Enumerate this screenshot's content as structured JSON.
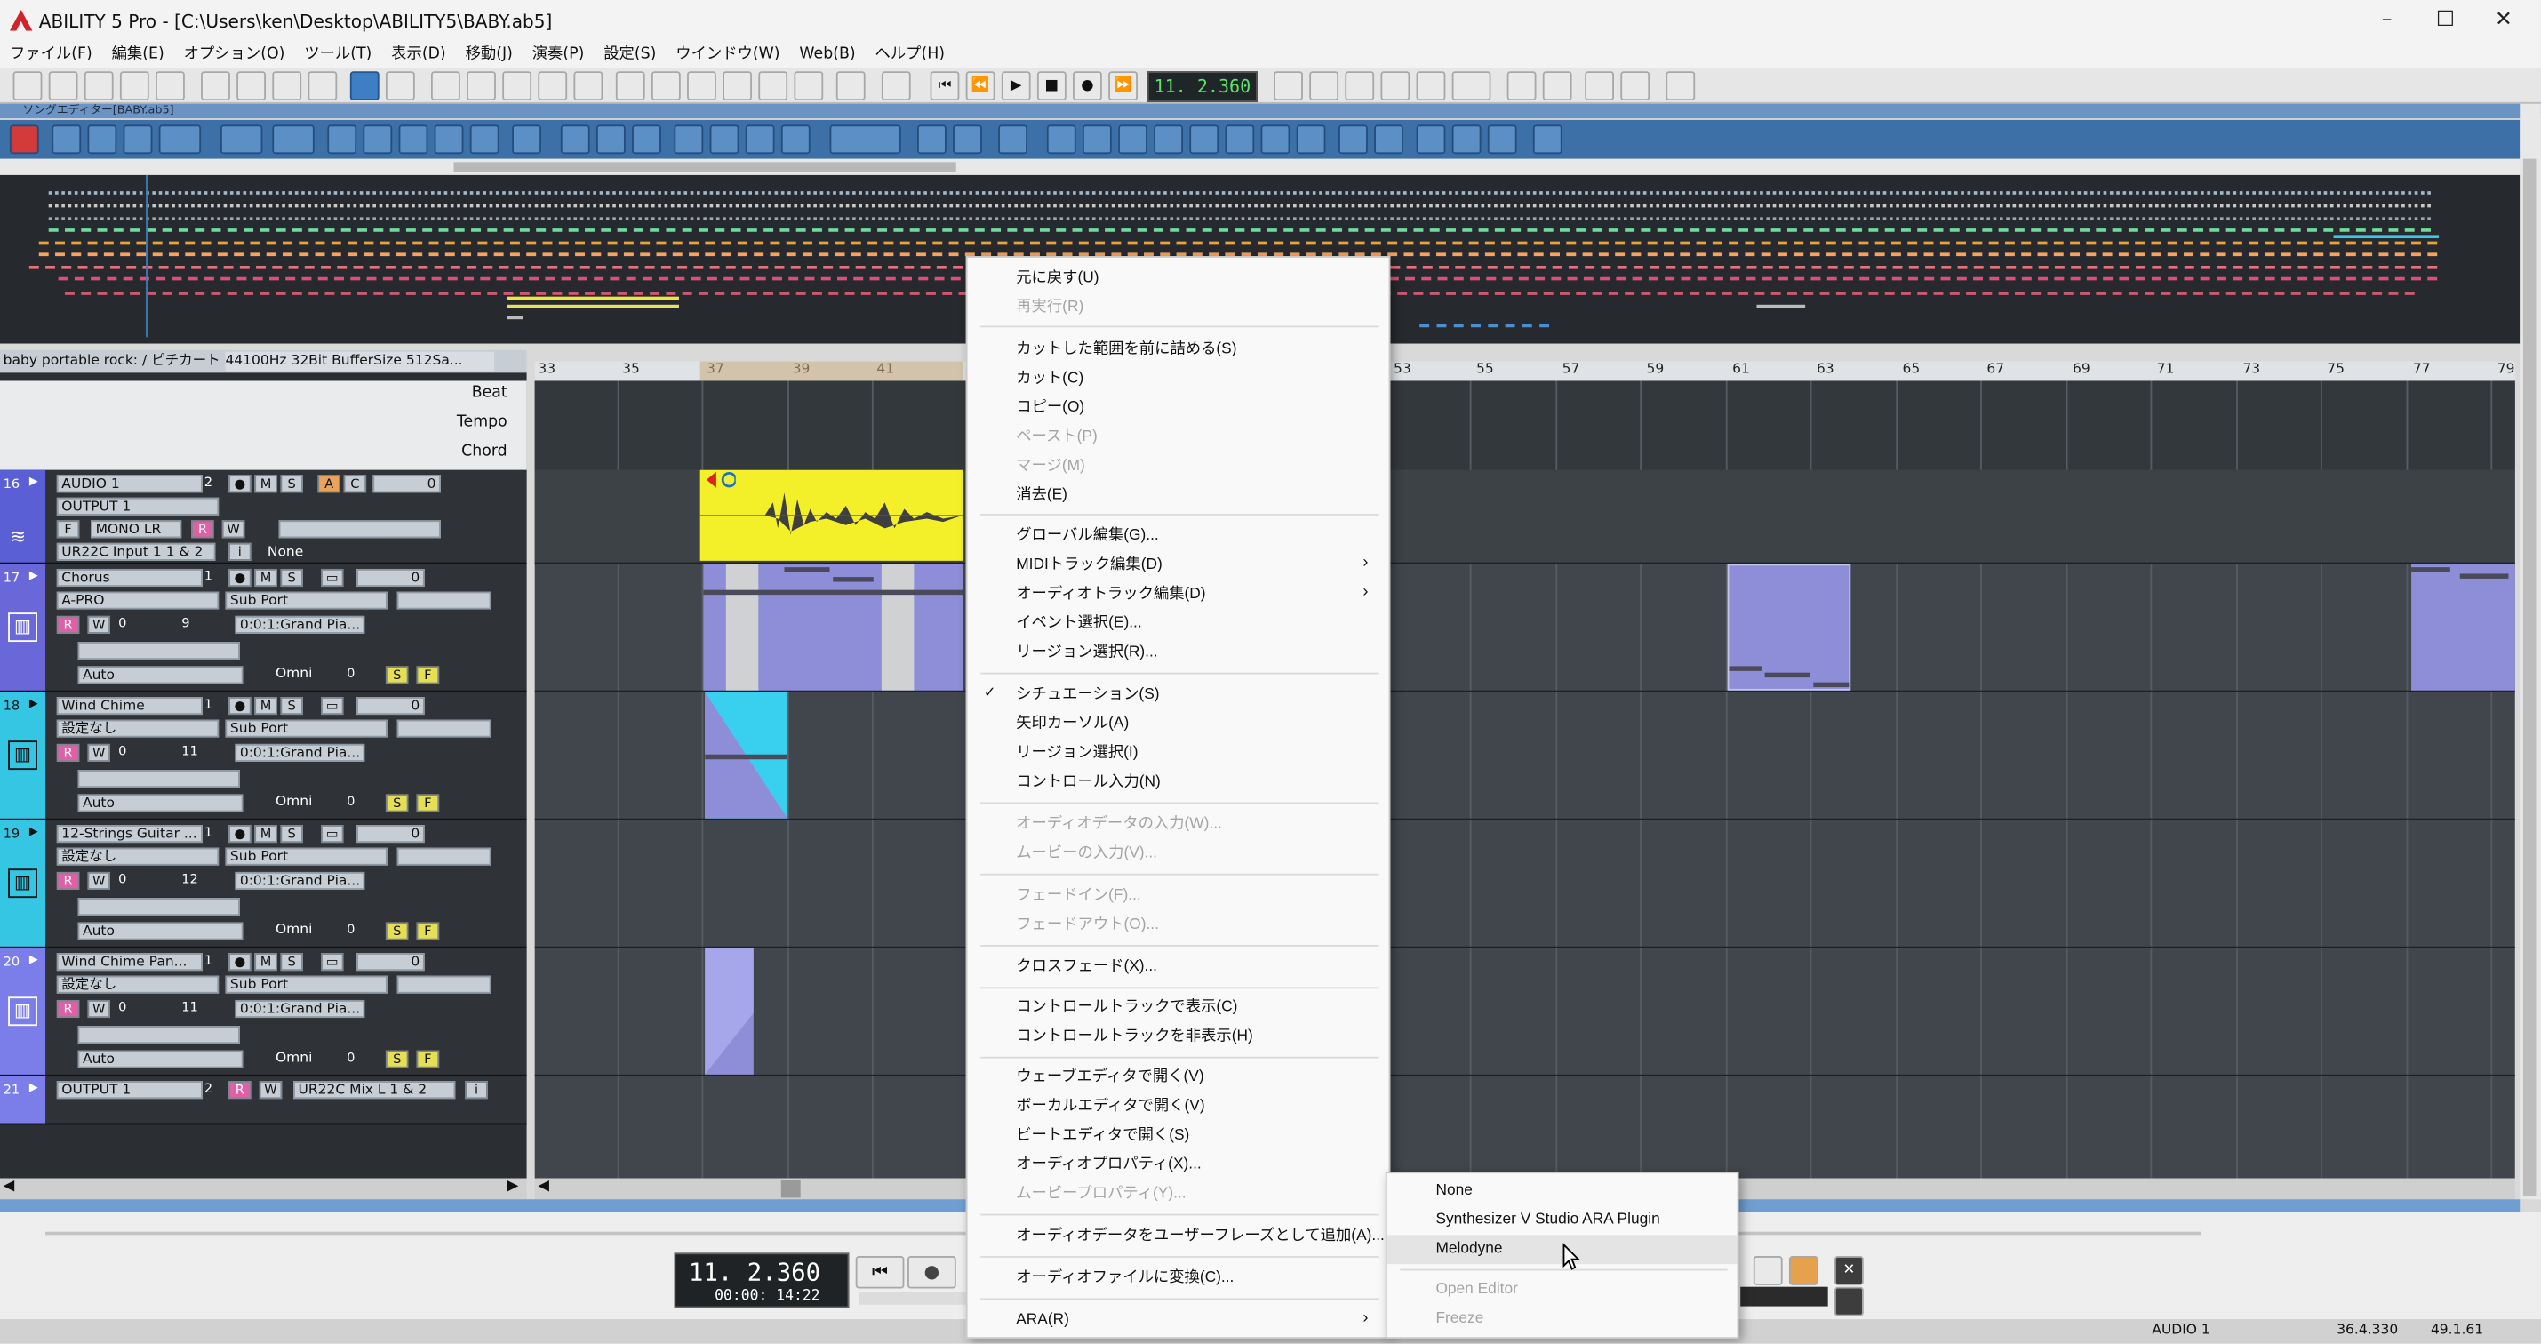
{
  "window": {
    "title": "ABILITY 5 Pro - [C:\\Users\\ken\\Desktop\\ABILITY5\\BABY.ab5]"
  },
  "menubar": [
    "ファイル(F)",
    "編集(E)",
    "オプション(O)",
    "ツール(T)",
    "表示(D)",
    "移動(J)",
    "演奏(P)",
    "設定(S)",
    "ウインドウ(W)",
    "Web(B)",
    "ヘルプ(H)"
  ],
  "transport": {
    "position": "11. 2.360",
    "time": "00:00: 14:22"
  },
  "song_editor": {
    "tab": "ソングエディター[BABY.ab5]",
    "device": "baby portable rock: / ピチカート・",
    "audio_info": "44100Hz 32Bit BufferSize 512Sa...",
    "rows": [
      "Beat",
      "Tempo",
      "Chord"
    ],
    "ruler": [
      "33",
      "35",
      "37",
      "39",
      "41",
      "53",
      "55",
      "57",
      "59",
      "61",
      "63",
      "65",
      "67",
      "69",
      "71",
      "73",
      "75",
      "77",
      "79"
    ]
  },
  "tracks": [
    {
      "no": "16",
      "name": "AUDIO 1",
      "ch": "2",
      "out": "OUTPUT 1",
      "mode": "MONO LR",
      "input": "UR22C Input 1 1 & 2",
      "input2": "None",
      "btn_a": "A",
      "btn_c": "C",
      "vol": "0",
      "color": "#5b5fd6"
    },
    {
      "no": "17",
      "name": "Chorus",
      "ch": "1",
      "port": "A-PRO",
      "sub": "Sub Port",
      "prog": "0:0:1:Grand Pia...",
      "num": "9",
      "auto": "Auto",
      "omni": "Omni",
      "vol": "0",
      "pan": "0",
      "color": "#6a68d8"
    },
    {
      "no": "18",
      "name": "Wind Chime",
      "ch": "1",
      "port": "設定なし",
      "sub": "Sub Port",
      "prog": "0:0:1:Grand Pia...",
      "num": "11",
      "auto": "Auto",
      "omni": "Omni",
      "vol": "0",
      "pan": "0",
      "color": "#35c6e3"
    },
    {
      "no": "19",
      "name": "12-Strings Guitar ...",
      "ch": "1",
      "port": "設定なし",
      "sub": "Sub Port",
      "prog": "0:0:1:Grand Pia...",
      "num": "12",
      "auto": "Auto",
      "omni": "Omni",
      "vol": "0",
      "pan": "0",
      "color": "#35c6e3"
    },
    {
      "no": "20",
      "name": "Wind Chime Pan...",
      "ch": "1",
      "port": "設定なし",
      "sub": "Sub Port",
      "prog": "0:0:1:Grand Pia...",
      "num": "11",
      "auto": "Auto",
      "omni": "Omni",
      "vol": "0",
      "pan": "0",
      "color": "#7b7ee8"
    },
    {
      "no": "21",
      "name": "OUTPUT 1",
      "ch": "2",
      "out": "UR22C Mix L 1 & 2",
      "color": "#7b7ee8"
    }
  ],
  "context_menu": {
    "items": [
      {
        "label": "元に戻す(U)",
        "enabled": true
      },
      {
        "label": "再実行(R)",
        "enabled": false
      },
      {
        "label": "カットした範囲を前に詰める(S)",
        "enabled": true
      },
      {
        "label": "カット(C)",
        "enabled": true
      },
      {
        "label": "コピー(O)",
        "enabled": true
      },
      {
        "label": "ペースト(P)",
        "enabled": false
      },
      {
        "label": "マージ(M)",
        "enabled": false
      },
      {
        "label": "消去(E)",
        "enabled": true
      },
      {
        "label": "グローバル編集(G)...",
        "enabled": true
      },
      {
        "label": "MIDIトラック編集(D)",
        "enabled": true,
        "submenu": true
      },
      {
        "label": "オーディオトラック編集(D)",
        "enabled": true,
        "submenu": true
      },
      {
        "label": "イベント選択(E)...",
        "enabled": true
      },
      {
        "label": "リージョン選択(R)...",
        "enabled": true
      },
      {
        "label": "シチュエーション(S)",
        "enabled": true,
        "checked": true
      },
      {
        "label": "矢印カーソル(A)",
        "enabled": true
      },
      {
        "label": "リージョン選択(I)",
        "enabled": true
      },
      {
        "label": "コントロール入力(N)",
        "enabled": true
      },
      {
        "label": "オーディオデータの入力(W)...",
        "enabled": false
      },
      {
        "label": "ムービーの入力(V)...",
        "enabled": false
      },
      {
        "label": "フェードイン(F)...",
        "enabled": false
      },
      {
        "label": "フェードアウト(O)...",
        "enabled": false
      },
      {
        "label": "クロスフェード(X)...",
        "enabled": true
      },
      {
        "label": "コントロールトラックで表示(C)",
        "enabled": true
      },
      {
        "label": "コントロールトラックを非表示(H)",
        "enabled": true
      },
      {
        "label": "ウェーブエディタで開く(V)",
        "enabled": true
      },
      {
        "label": "ボーカルエディタで開く(V)",
        "enabled": true
      },
      {
        "label": "ビートエディタで開く(S)",
        "enabled": true
      },
      {
        "label": "オーディオプロパティ(X)...",
        "enabled": true
      },
      {
        "label": "ムービープロパティ(Y)...",
        "enabled": false
      },
      {
        "label": "オーディオデータをユーザーフレーズとして追加(A)...",
        "enabled": true
      },
      {
        "label": "オーディオファイルに変換(C)...",
        "enabled": true
      },
      {
        "label": "ARA(R)",
        "enabled": true,
        "submenu": true
      }
    ],
    "submenu_ara": [
      {
        "label": "None",
        "enabled": true
      },
      {
        "label": "Synthesizer V Studio ARA Plugin",
        "enabled": true
      },
      {
        "label": "Melodyne",
        "enabled": true,
        "hover": true
      },
      {
        "label": "Open Editor",
        "enabled": false
      },
      {
        "label": "Freeze",
        "enabled": false
      }
    ]
  },
  "statusbar": {
    "track": "AUDIO 1",
    "pos1": "36.4.330",
    "pos2": "49.1.61"
  }
}
